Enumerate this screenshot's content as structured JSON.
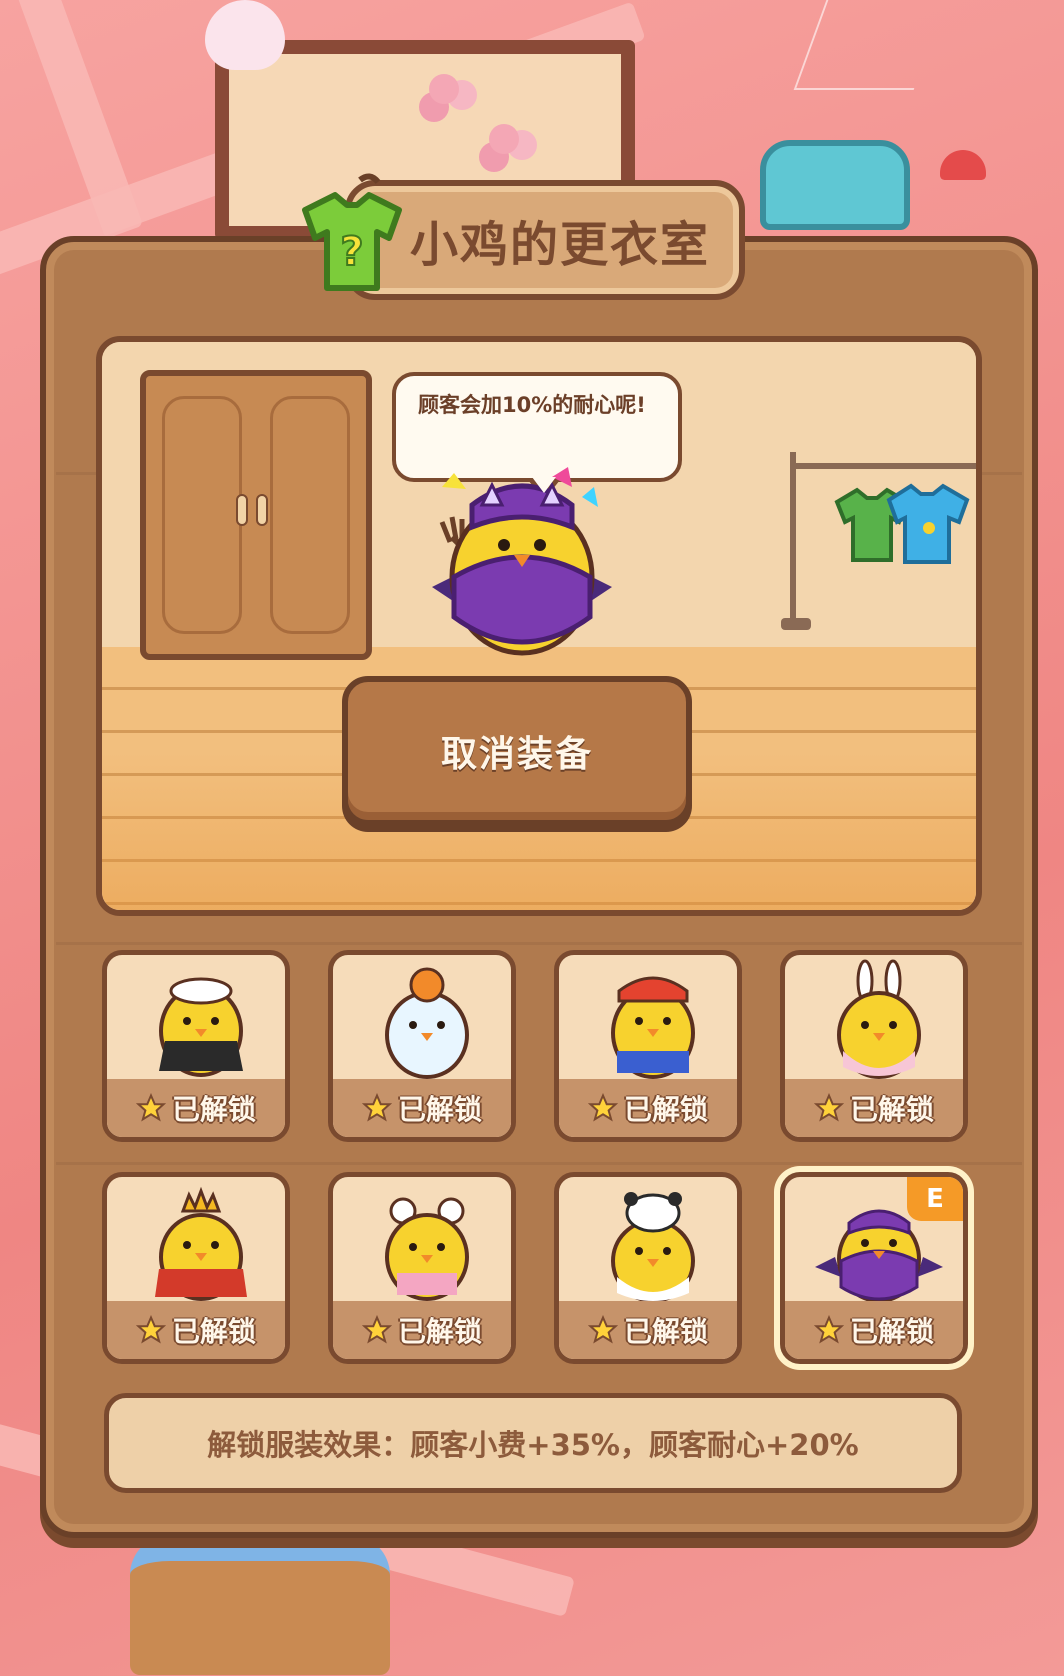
{
  "title": "小鸡的更衣室",
  "speech_bubble": "顾客会加10%的耐心呢!",
  "unequip_button": "取消装备",
  "outfits": [
    {
      "name": "maid-outfit",
      "status": "已解锁",
      "body": "#f7d22e",
      "accent": "#2a2a2a",
      "equipped": false
    },
    {
      "name": "pumpkin-ghost-outfit",
      "status": "已解锁",
      "body": "#e8f6ff",
      "accent": "#f28a2a",
      "equipped": false
    },
    {
      "name": "plumber-outfit",
      "status": "已解锁",
      "body": "#f7d22e",
      "accent": "#e4432f",
      "equipped": false
    },
    {
      "name": "bunny-outfit",
      "status": "已解锁",
      "body": "#f7d22e",
      "accent": "#f7c6d6",
      "equipped": false
    },
    {
      "name": "king-outfit",
      "status": "已解锁",
      "body": "#f7d22e",
      "accent": "#d33a2a",
      "equipped": false
    },
    {
      "name": "bun-hair-outfit",
      "status": "已解锁",
      "body": "#f7d22e",
      "accent": "#f4a6c2",
      "equipped": false
    },
    {
      "name": "panda-outfit",
      "status": "已解锁",
      "body": "#f7d22e",
      "accent": "#ffffff",
      "equipped": false
    },
    {
      "name": "devil-outfit",
      "status": "已解锁",
      "body": "#7b3bb0",
      "accent": "#6a2aa0",
      "equipped": true,
      "badge": "E"
    }
  ],
  "effect_text": "解锁服装效果：顾客小费+35%，顾客耐心+20%",
  "colors": {
    "board": "#b07a4e",
    "border": "#7a4a2f",
    "badge": "#f59a27",
    "star": "#ffd23a"
  }
}
